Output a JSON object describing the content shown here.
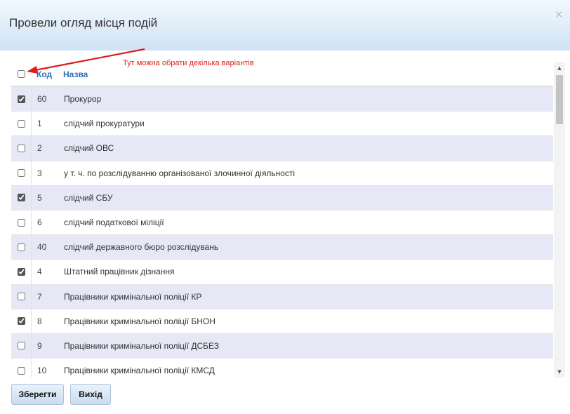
{
  "dialog": {
    "title": "Провели огляд місця подій",
    "close_label": "×",
    "hint": "Тут можна обрати декілька варіантів"
  },
  "table": {
    "header": {
      "code": "Код",
      "name": "Назва",
      "select_all_checked": false
    },
    "rows": [
      {
        "checked": true,
        "code": "60",
        "name": "Прокурор"
      },
      {
        "checked": false,
        "code": "1",
        "name": "слідчий прокуратури"
      },
      {
        "checked": false,
        "code": "2",
        "name": "слідчий ОВС"
      },
      {
        "checked": false,
        "code": "3",
        "name": "у т. ч. по розслідуванню організованої злочинної діяльності"
      },
      {
        "checked": true,
        "code": "5",
        "name": "слідчий СБУ"
      },
      {
        "checked": false,
        "code": "6",
        "name": "слідчий податкової міліції"
      },
      {
        "checked": false,
        "code": "40",
        "name": "слідчий державного бюро розслідувань"
      },
      {
        "checked": true,
        "code": "4",
        "name": "Штатний працівник дізнання"
      },
      {
        "checked": false,
        "code": "7",
        "name": "Працівники кримінальної поліції КР"
      },
      {
        "checked": true,
        "code": "8",
        "name": "Працівники кримінальної поліції БНОН"
      },
      {
        "checked": false,
        "code": "9",
        "name": "Працівники кримінальної поліції ДСБЕЗ"
      },
      {
        "checked": false,
        "code": "10",
        "name": "Працівники кримінальної поліції КМСД"
      }
    ]
  },
  "scrollbar": {
    "up_icon": "▲",
    "down_icon": "▼"
  },
  "buttons": {
    "save": "Зберегти",
    "exit": "Вихід"
  },
  "colors": {
    "header_gradient_top": "#f2f8fd",
    "header_gradient_bottom": "#cfe3f5",
    "row_alt": "#e6e8f6",
    "hint": "#e01b1b",
    "link_blue": "#2a6fb4"
  }
}
